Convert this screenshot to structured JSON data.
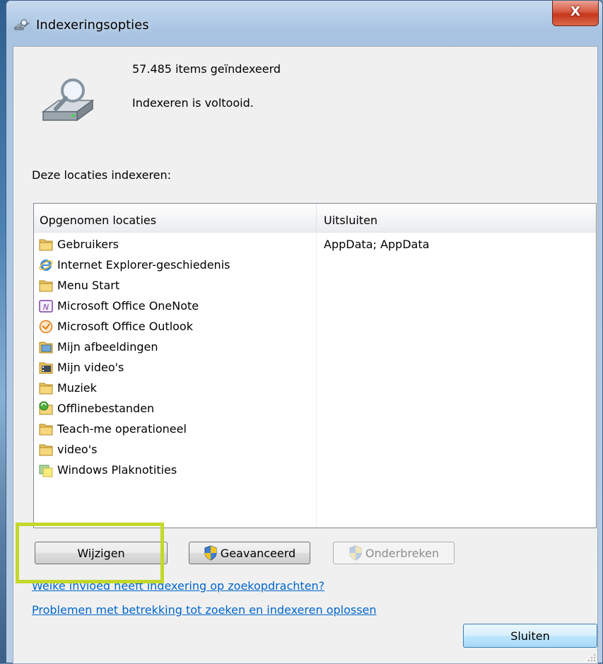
{
  "window": {
    "title": "Indexeringsopties",
    "close_glyph": "X"
  },
  "status": {
    "items_indexed": "57.485 items geïndexeerd",
    "state": "Indexeren is voltooid."
  },
  "section_label": "Deze locaties indexeren:",
  "list": {
    "columns": [
      "Opgenomen locaties",
      "Uitsluiten"
    ],
    "rows": [
      {
        "label": "Gebruikers",
        "exclude": "AppData; AppData",
        "icon": "folder-icon"
      },
      {
        "label": "Internet Explorer-geschiedenis",
        "exclude": "",
        "icon": "internet-explorer-icon"
      },
      {
        "label": "Menu Start",
        "exclude": "",
        "icon": "folder-icon"
      },
      {
        "label": "Microsoft Office OneNote",
        "exclude": "",
        "icon": "onenote-icon"
      },
      {
        "label": "Microsoft Office Outlook",
        "exclude": "",
        "icon": "outlook-icon"
      },
      {
        "label": "Mijn afbeeldingen",
        "exclude": "",
        "icon": "pictures-folder-icon"
      },
      {
        "label": "Mijn video's",
        "exclude": "",
        "icon": "videos-folder-icon"
      },
      {
        "label": "Muziek",
        "exclude": "",
        "icon": "folder-icon"
      },
      {
        "label": "Offlinebestanden",
        "exclude": "",
        "icon": "offline-files-icon"
      },
      {
        "label": "Teach-me operationeel",
        "exclude": "",
        "icon": "folder-icon"
      },
      {
        "label": "video's",
        "exclude": "",
        "icon": "folder-icon"
      },
      {
        "label": "Windows Plaknotities",
        "exclude": "",
        "icon": "sticky-notes-icon"
      }
    ]
  },
  "buttons": {
    "modify": "Wijzigen",
    "advanced": "Geavanceerd",
    "pause": "Onderbreken",
    "close": "Sluiten"
  },
  "links": {
    "help_search": "Welke invloed heeft indexering op zoekopdrachten?",
    "troubleshoot": "Problemen met betrekking tot zoeken en indexeren oplossen"
  },
  "colors": {
    "highlight": "#c3d82b",
    "link": "#0066cc"
  }
}
